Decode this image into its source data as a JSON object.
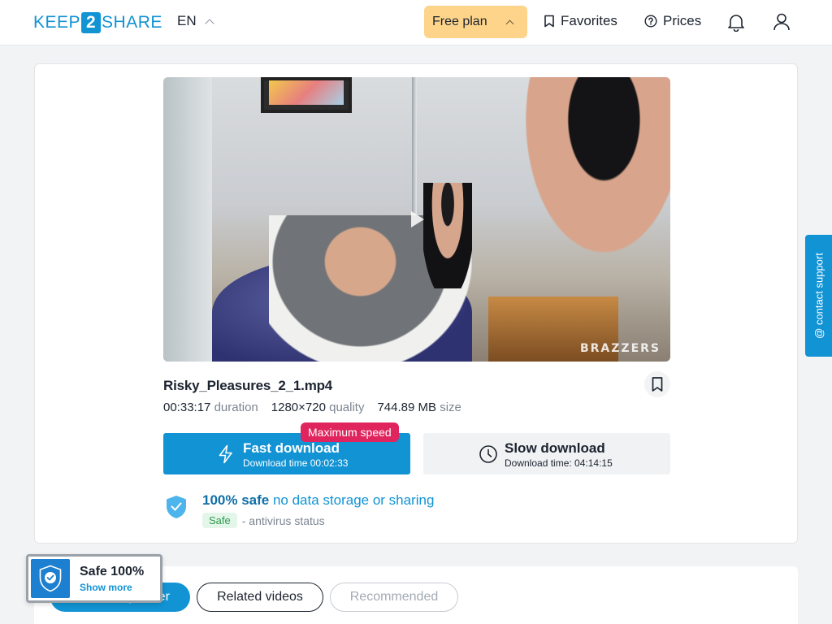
{
  "header": {
    "logo": {
      "part1": "KEEP",
      "part2": "2",
      "part3": "SHARE"
    },
    "language": "EN",
    "plan_label": "Free plan",
    "favorites_label": "Favorites",
    "prices_label": "Prices"
  },
  "file": {
    "name": "Risky_Pleasures_2_1.mp4",
    "duration_value": "00:33:17",
    "duration_label": "duration",
    "quality_value": "1280×720",
    "quality_label": "quality",
    "size_value": "744.89 MB",
    "size_label": "size",
    "watermark": "BRAZZERS"
  },
  "download": {
    "fast_label": "Fast download",
    "fast_time": "Download time 00:02:33",
    "speed_badge": "Maximum speed",
    "slow_label": "Slow download",
    "slow_time": "Download time: 04:14:15"
  },
  "safety": {
    "headline_strong": "100% safe",
    "headline_light": "no data storage or sharing",
    "av_badge": "Safe",
    "av_text": "- antivirus status"
  },
  "tabs": {
    "partner": "From this partner",
    "related": "Related videos",
    "recommended": "Recommended"
  },
  "widget": {
    "title": "Safe 100%",
    "more": "Show more"
  },
  "support": {
    "label": "@ contact support"
  },
  "colors": {
    "accent": "#1193d4",
    "plan": "#fdd48a",
    "badge": "#e0245e"
  }
}
